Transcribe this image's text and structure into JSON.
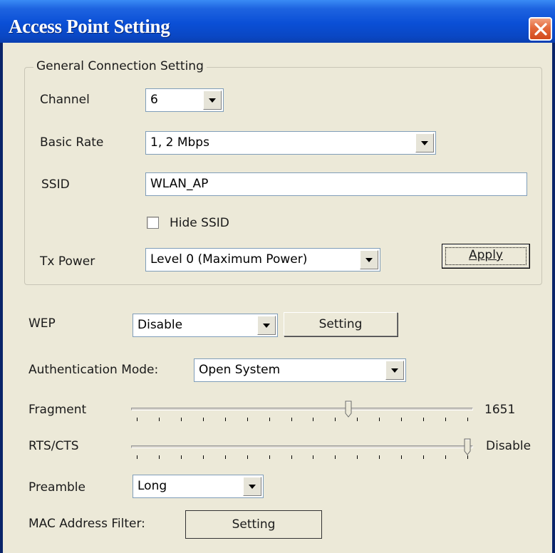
{
  "window": {
    "title": "Access Point Setting",
    "close_icon": "close-icon"
  },
  "general": {
    "legend": "General Connection Setting",
    "channel": {
      "label": "Channel",
      "value": "6"
    },
    "basic_rate": {
      "label": "Basic Rate",
      "value": "1, 2 Mbps"
    },
    "ssid": {
      "label": "SSID",
      "value": "WLAN_AP"
    },
    "hide_ssid": {
      "label": "Hide SSID",
      "checked": false
    },
    "tx_power": {
      "label": "Tx Power",
      "value": "Level 0 (Maximum Power)"
    },
    "apply_label": "Apply"
  },
  "wep": {
    "label": "WEP",
    "value": "Disable",
    "setting_label": "Setting"
  },
  "auth": {
    "label": "Authentication Mode:",
    "value": "Open System"
  },
  "fragment": {
    "label": "Fragment",
    "value_text": "1651",
    "position": 0.64,
    "tick_count": 16
  },
  "rts": {
    "label": "RTS/CTS",
    "value_text": "Disable",
    "position": 1.0,
    "tick_count": 16
  },
  "preamble": {
    "label": "Preamble",
    "value": "Long"
  },
  "mac_filter": {
    "label": "MAC Address Filter:",
    "setting_label": "Setting"
  },
  "colors": {
    "titlebar": "#0a4fd6",
    "dialog_bg": "#ece9d8",
    "close_button": "#e46a3c"
  }
}
